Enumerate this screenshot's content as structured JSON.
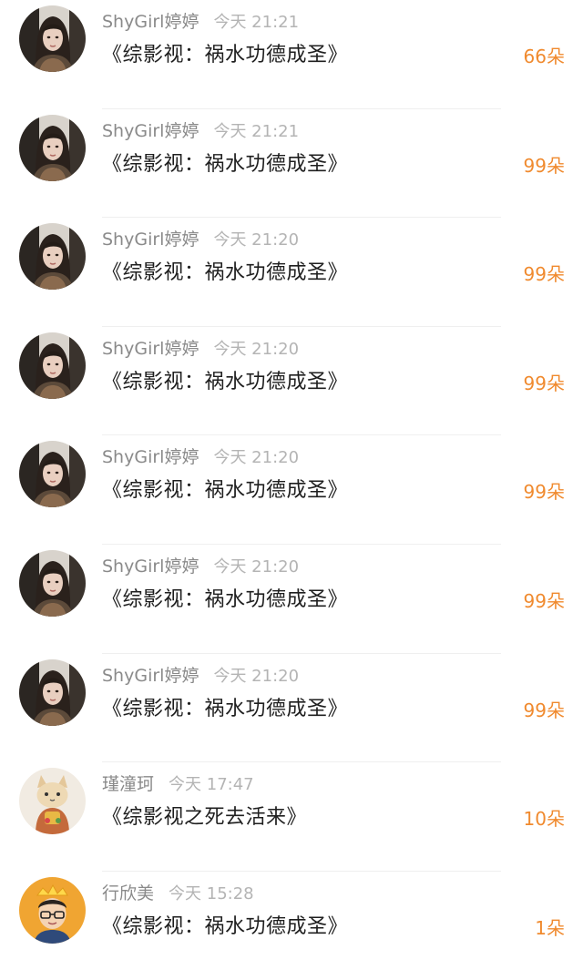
{
  "gift_list": [
    {
      "user": "ShyGirl婷婷",
      "time": "今天 21:21",
      "title": "《综影视：祸水功德成圣》",
      "count": "66朵",
      "avatar": "woman-long-hair"
    },
    {
      "user": "ShyGirl婷婷",
      "time": "今天 21:21",
      "title": "《综影视：祸水功德成圣》",
      "count": "99朵",
      "avatar": "woman-long-hair"
    },
    {
      "user": "ShyGirl婷婷",
      "time": "今天 21:20",
      "title": "《综影视：祸水功德成圣》",
      "count": "99朵",
      "avatar": "woman-long-hair"
    },
    {
      "user": "ShyGirl婷婷",
      "time": "今天 21:20",
      "title": "《综影视：祸水功德成圣》",
      "count": "99朵",
      "avatar": "woman-long-hair"
    },
    {
      "user": "ShyGirl婷婷",
      "time": "今天 21:20",
      "title": "《综影视：祸水功德成圣》",
      "count": "99朵",
      "avatar": "woman-long-hair"
    },
    {
      "user": "ShyGirl婷婷",
      "time": "今天 21:20",
      "title": "《综影视：祸水功德成圣》",
      "count": "99朵",
      "avatar": "woman-long-hair"
    },
    {
      "user": "ShyGirl婷婷",
      "time": "今天 21:20",
      "title": "《综影视：祸水功德成圣》",
      "count": "99朵",
      "avatar": "woman-long-hair"
    },
    {
      "user": "瑾潼珂",
      "time": "今天 17:47",
      "title": "《综影视之死去活来》",
      "count": "10朵",
      "avatar": "cartoon-cat"
    },
    {
      "user": "行欣美",
      "time": "今天 15:28",
      "title": "《综影视：祸水功德成圣》",
      "count": "1朵",
      "avatar": "crowned-boy"
    }
  ],
  "colors": {
    "count": "#f08a2e",
    "name": "#8a8a8a",
    "time": "#b4b4b4",
    "title": "#1f1f1f",
    "divider": "#efefef"
  }
}
